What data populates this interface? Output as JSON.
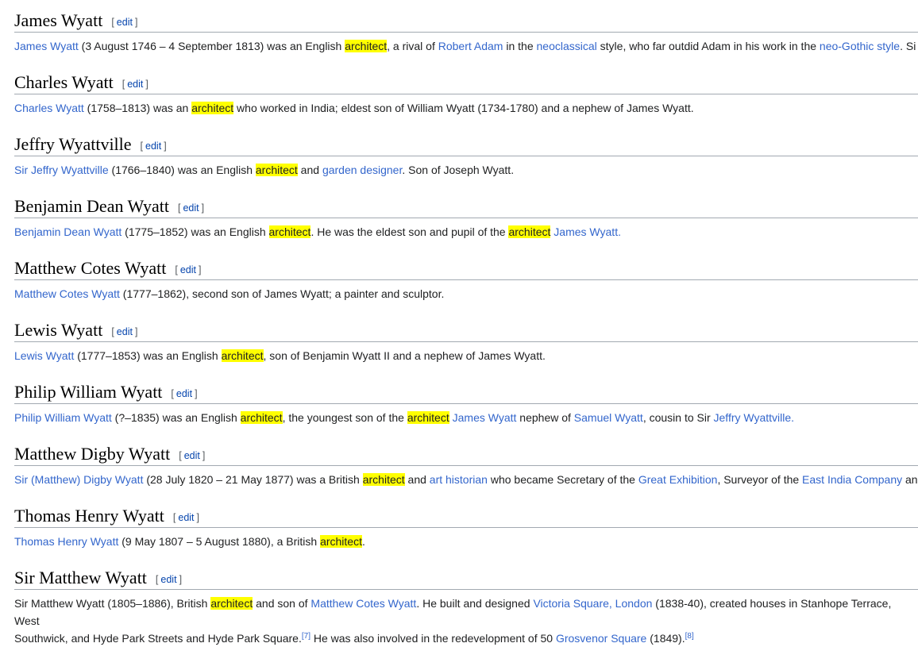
{
  "edit_label": "edit",
  "colors": {
    "link": "#3366cc",
    "highlight": "#ffff00",
    "heading_rule": "#a2a9b1",
    "text": "#202122"
  },
  "sections": [
    {
      "title": "James Wyatt",
      "paragraph": [
        {
          "t": "link",
          "v": "James Wyatt"
        },
        {
          "t": "text",
          "v": " (3 August 1746 – 4 September 1813) was an English "
        },
        {
          "t": "hl",
          "v": "architect"
        },
        {
          "t": "text",
          "v": ", a rival of "
        },
        {
          "t": "link",
          "v": "Robert Adam"
        },
        {
          "t": "text",
          "v": " in the "
        },
        {
          "t": "link",
          "v": "neoclassical"
        },
        {
          "t": "text",
          "v": " style, who far outdid Adam in his work in the "
        },
        {
          "t": "link",
          "v": "neo-Gothic style"
        },
        {
          "t": "text",
          "v": ". Si"
        }
      ]
    },
    {
      "title": "Charles Wyatt",
      "paragraph": [
        {
          "t": "link",
          "v": "Charles Wyatt"
        },
        {
          "t": "text",
          "v": " (1758–1813) was an "
        },
        {
          "t": "hl",
          "v": "architect"
        },
        {
          "t": "text",
          "v": " who worked in India; eldest son of William Wyatt (1734-1780) and a nephew of James Wyatt."
        }
      ]
    },
    {
      "title": "Jeffry Wyattville",
      "paragraph": [
        {
          "t": "link",
          "v": "Sir Jeffry Wyattville"
        },
        {
          "t": "text",
          "v": " (1766–1840) was an English "
        },
        {
          "t": "hl",
          "v": "architect"
        },
        {
          "t": "text",
          "v": " and "
        },
        {
          "t": "link",
          "v": "garden designer"
        },
        {
          "t": "text",
          "v": ". Son of Joseph Wyatt."
        }
      ]
    },
    {
      "title": "Benjamin Dean Wyatt",
      "paragraph": [
        {
          "t": "link",
          "v": "Benjamin Dean Wyatt"
        },
        {
          "t": "text",
          "v": " (1775–1852) was an English "
        },
        {
          "t": "hl",
          "v": "architect"
        },
        {
          "t": "text",
          "v": ". He was the eldest son and pupil of the "
        },
        {
          "t": "hl",
          "v": "architect"
        },
        {
          "t": "text",
          "v": " "
        },
        {
          "t": "link",
          "v": "James Wyatt."
        }
      ]
    },
    {
      "title": "Matthew Cotes Wyatt",
      "paragraph": [
        {
          "t": "link",
          "v": "Matthew Cotes Wyatt"
        },
        {
          "t": "text",
          "v": " (1777–1862), second son of James Wyatt; a painter and sculptor."
        }
      ]
    },
    {
      "title": "Lewis Wyatt",
      "paragraph": [
        {
          "t": "link",
          "v": "Lewis Wyatt"
        },
        {
          "t": "text",
          "v": " (1777–1853) was an English "
        },
        {
          "t": "hl",
          "v": "architect"
        },
        {
          "t": "text",
          "v": ", son of Benjamin Wyatt II and a nephew of James Wyatt."
        }
      ]
    },
    {
      "title": "Philip William Wyatt",
      "paragraph": [
        {
          "t": "link",
          "v": "Philip William Wyatt"
        },
        {
          "t": "text",
          "v": " (?–1835) was an English "
        },
        {
          "t": "hl",
          "v": "architect"
        },
        {
          "t": "text",
          "v": ", the youngest son of the "
        },
        {
          "t": "hl",
          "v": "architect"
        },
        {
          "t": "text",
          "v": " "
        },
        {
          "t": "link",
          "v": "James Wyatt"
        },
        {
          "t": "text",
          "v": " nephew of "
        },
        {
          "t": "link",
          "v": "Samuel Wyatt"
        },
        {
          "t": "text",
          "v": ", cousin to Sir "
        },
        {
          "t": "link",
          "v": "Jeffry Wyattville."
        }
      ]
    },
    {
      "title": "Matthew Digby Wyatt",
      "paragraph": [
        {
          "t": "link",
          "v": "Sir (Matthew) Digby Wyatt"
        },
        {
          "t": "text",
          "v": " (28 July 1820 – 21 May 1877) was a British "
        },
        {
          "t": "hl",
          "v": "architect"
        },
        {
          "t": "text",
          "v": " and "
        },
        {
          "t": "link",
          "v": "art historian"
        },
        {
          "t": "text",
          "v": " who became Secretary of the "
        },
        {
          "t": "link",
          "v": "Great Exhibition"
        },
        {
          "t": "text",
          "v": ", Surveyor of the "
        },
        {
          "t": "link",
          "v": "East India Company"
        },
        {
          "t": "text",
          "v": " an"
        }
      ]
    },
    {
      "title": "Thomas Henry Wyatt",
      "paragraph": [
        {
          "t": "link",
          "v": "Thomas Henry Wyatt"
        },
        {
          "t": "text",
          "v": " (9 May 1807 – 5 August 1880), a British "
        },
        {
          "t": "hl",
          "v": "architect"
        },
        {
          "t": "text",
          "v": "."
        }
      ]
    },
    {
      "title": "Sir Matthew Wyatt",
      "wrap": true,
      "paragraph": [
        {
          "t": "text",
          "v": "Sir Matthew Wyatt (1805–1886), British "
        },
        {
          "t": "hl",
          "v": "architect"
        },
        {
          "t": "text",
          "v": " and son of "
        },
        {
          "t": "link",
          "v": "Matthew Cotes Wyatt"
        },
        {
          "t": "text",
          "v": ". He built and designed "
        },
        {
          "t": "link",
          "v": "Victoria Square, London"
        },
        {
          "t": "text",
          "v": " (1838-40), created houses in Stanhope Terrace, West"
        },
        {
          "t": "br"
        },
        {
          "t": "text",
          "v": "Southwick, and Hyde Park Streets and Hyde Park Square."
        },
        {
          "t": "ref",
          "v": "[7]"
        },
        {
          "t": "text",
          "v": " He was also involved in the redevelopment of 50 "
        },
        {
          "t": "link",
          "v": "Grosvenor Square"
        },
        {
          "t": "text",
          "v": " (1849)."
        },
        {
          "t": "ref",
          "v": "[8]"
        }
      ]
    }
  ]
}
